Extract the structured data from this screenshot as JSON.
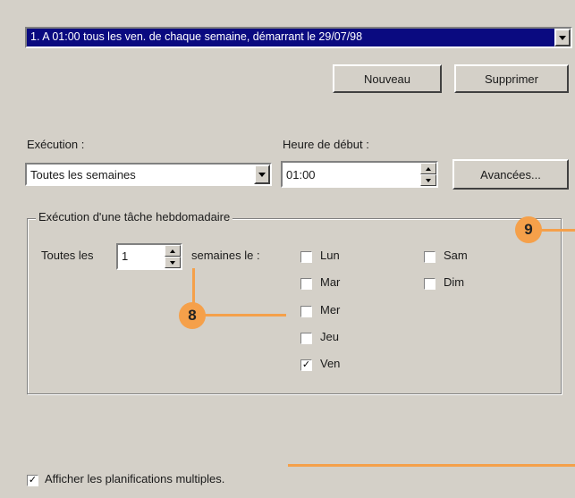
{
  "schedule_list": {
    "selected": "1. A 01:00 tous les ven. de chaque semaine, démarrant le 29/07/98"
  },
  "buttons": {
    "new": "Nouveau",
    "delete": "Supprimer",
    "advanced": "Avancées..."
  },
  "execution": {
    "label": "Exécution :",
    "selected": "Toutes les semaines"
  },
  "start_time": {
    "label": "Heure de début :",
    "value": "01:00"
  },
  "weekly": {
    "group_title": "Exécution d'une tâche hebdomadaire",
    "every_label": "Toutes les",
    "every_value": "1",
    "weeks_on_label": "semaines le :",
    "days": [
      {
        "label": "Lun",
        "checked": false
      },
      {
        "label": "Mar",
        "checked": false
      },
      {
        "label": "Mer",
        "checked": false
      },
      {
        "label": "Jeu",
        "checked": false
      },
      {
        "label": "Ven",
        "checked": true
      },
      {
        "label": "Sam",
        "checked": false
      },
      {
        "label": "Dim",
        "checked": false
      }
    ]
  },
  "show_multiple": {
    "label": "Afficher les planifications multiples.",
    "checked": true
  },
  "callouts": {
    "c8": "8",
    "c9": "9"
  },
  "colors": {
    "highlight": "#0a0a80",
    "callout": "#f5a04a",
    "dialog_bg": "#d4d0c8"
  }
}
